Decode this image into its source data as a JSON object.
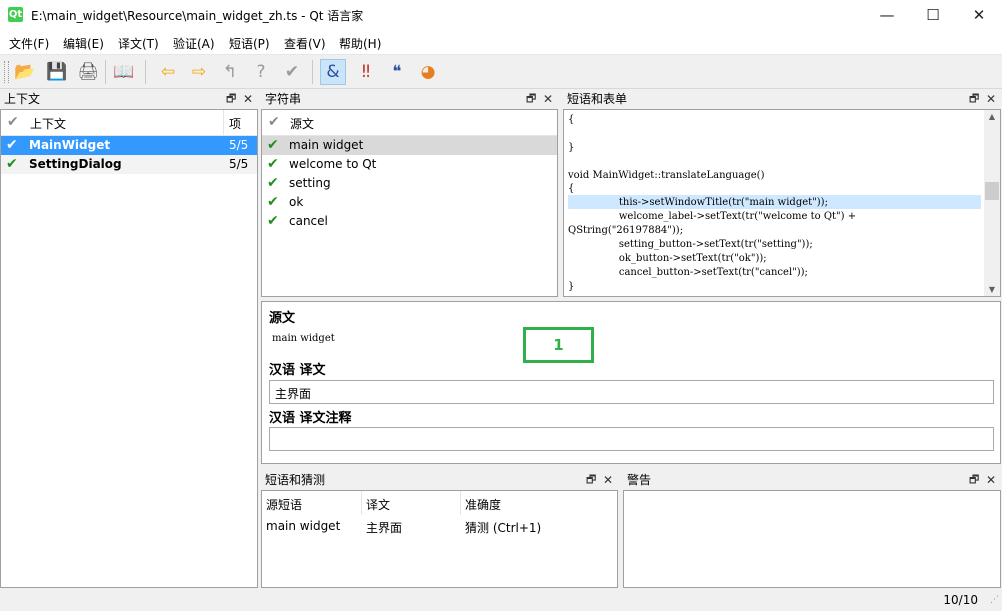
{
  "window": {
    "app_icon": "Qt",
    "title": "E:\\main_widget\\Resource\\main_widget_zh.ts - Qt 语言家",
    "buttons": {
      "minimize": "—",
      "maximize": "☐",
      "close": "✕"
    }
  },
  "menu": [
    "文件(F)",
    "编辑(E)",
    "译文(T)",
    "验证(A)",
    "短语(P)",
    "查看(V)",
    "帮助(H)"
  ],
  "toolbar": {
    "icons": [
      "open-icon",
      "save-icon",
      "print-icon",
      "phrasebook-icon",
      "prev-icon",
      "next-icon",
      "prev-unfinished-icon",
      "next-unfinished-icon",
      "done-and-next-icon",
      "accelerator-check-icon",
      "punctuation-check-icon",
      "phrase-check-icon",
      "placemarker-check-icon"
    ]
  },
  "context_panel": {
    "title": "上下文",
    "headers": {
      "context": "上下文",
      "items": "项"
    },
    "rows": [
      {
        "name": "MainWidget",
        "count": "5/5",
        "selected": true
      },
      {
        "name": "SettingDialog",
        "count": "5/5",
        "selected": false
      }
    ]
  },
  "strings_panel": {
    "title": "字符串",
    "header": "源文",
    "rows": [
      "main widget",
      "welcome to Qt",
      "setting",
      "ok",
      "cancel"
    ]
  },
  "sources_panel": {
    "title": "短语和表单",
    "lines": [
      "{",
      "",
      "}",
      "",
      "void MainWidget::translateLanguage()",
      "{",
      "                this->setWindowTitle(tr(\"main widget\"));",
      "                welcome_label->setText(tr(\"welcome to Qt\") +",
      "QString(\"26197884\"));",
      "                setting_button->setText(tr(\"setting\"));",
      "                ok_button->setText(tr(\"ok\"));",
      "                cancel_button->setText(tr(\"cancel\"));",
      "}"
    ]
  },
  "editor": {
    "source_label": "源文",
    "source_text": "main widget",
    "translation_label": "汉语  译文",
    "translation_value": "主界面",
    "comment_label": "汉语  译文注释",
    "comment_value": "",
    "marker": "1"
  },
  "phrases_panel": {
    "title": "短语和猜测",
    "headers": {
      "source": "源短语",
      "translation": "译文",
      "definition": "准确度"
    },
    "rows": [
      {
        "source": "main widget",
        "translation": "主界面",
        "definition": "猜测 (Ctrl+1)"
      }
    ]
  },
  "warnings_panel": {
    "title": "警告"
  },
  "status": {
    "progress": "10/10"
  },
  "colors": {
    "selection": "#3399ff",
    "highlight_line": "#cde8ff",
    "check_green": "#1f8f1f",
    "marker_green": "#2fb04a"
  }
}
